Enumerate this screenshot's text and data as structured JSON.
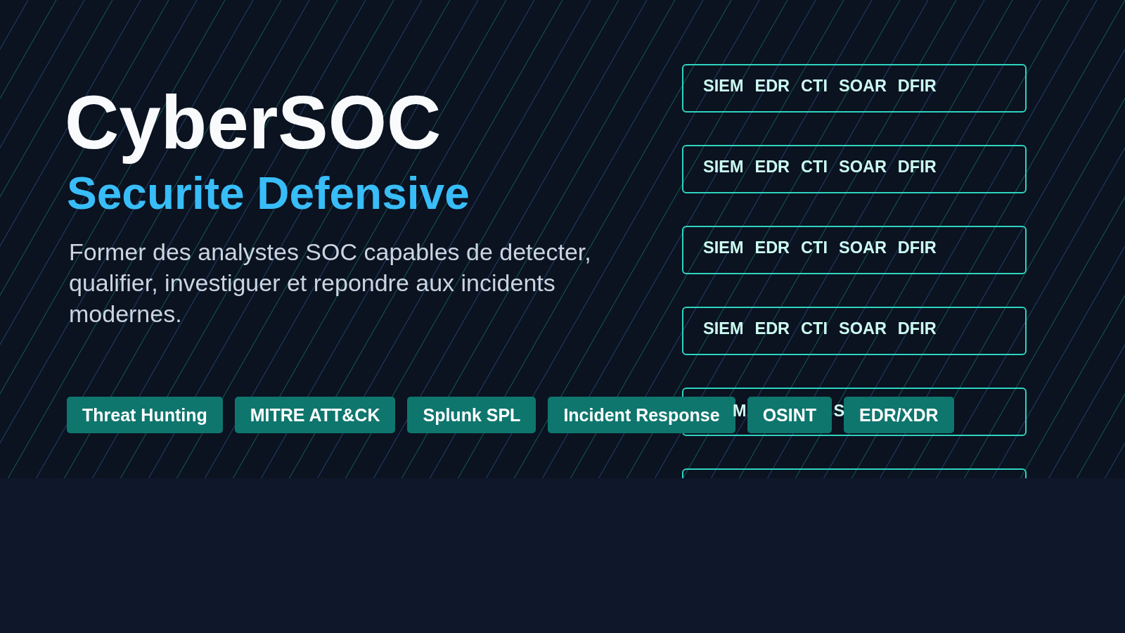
{
  "hero": {
    "title": "CyberSOC",
    "subtitle": "Securite Defensive",
    "description": "Former des analystes SOC capables de detecter, qualifier, investiguer et repondre aux incidents modernes.",
    "tags": [
      "Threat Hunting",
      "MITRE ATT&CK",
      "Splunk SPL",
      "Incident Response",
      "OSINT",
      "EDR/XDR"
    ],
    "panels": [
      {
        "kind": "full",
        "labels": [
          "SIEM",
          "EDR",
          "CTI",
          "SOAR",
          "DFIR"
        ]
      },
      {
        "kind": "full",
        "labels": [
          "SIEM",
          "EDR",
          "CTI",
          "SOAR",
          "DFIR"
        ]
      },
      {
        "kind": "full",
        "labels": [
          "SIEM",
          "EDR",
          "CTI",
          "SOAR",
          "DFIR"
        ]
      },
      {
        "kind": "full",
        "labels": [
          "SIEM",
          "EDR",
          "CTI",
          "SOAR",
          "DFIR"
        ]
      },
      {
        "kind": "covered",
        "labels": [
          "M",
          "S"
        ]
      },
      {
        "kind": "empty"
      }
    ]
  }
}
